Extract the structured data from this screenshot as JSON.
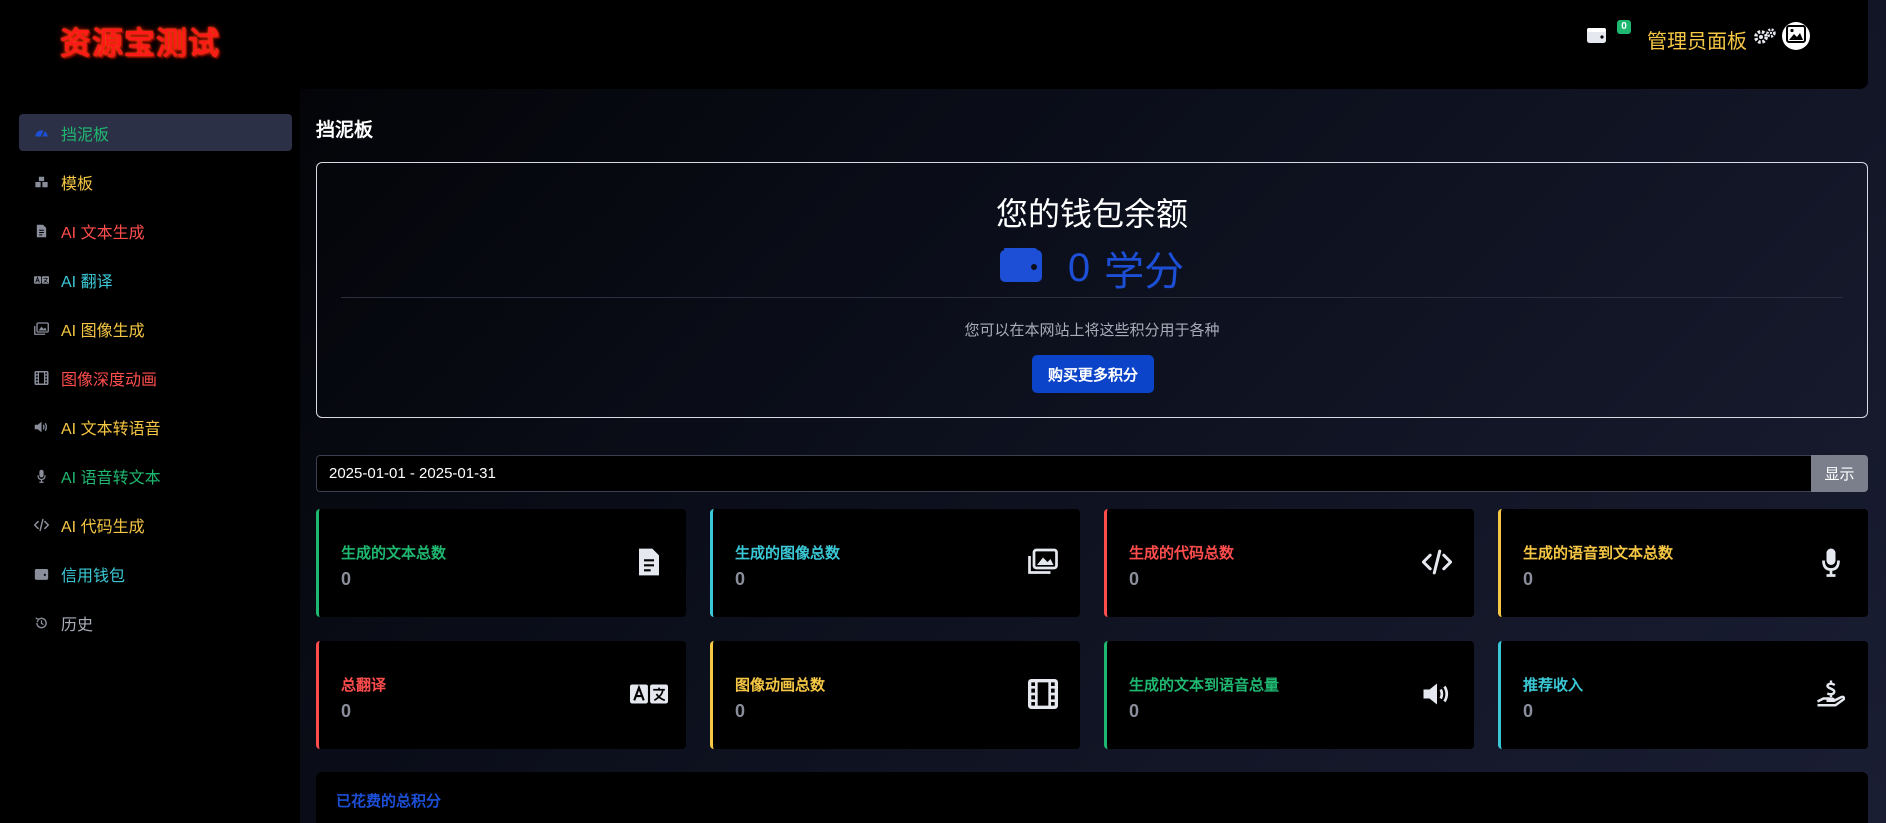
{
  "brand": {
    "name": "资源宝测试"
  },
  "sidebar": {
    "items": [
      {
        "label": "挡泥板",
        "icon": "dashboard-gauge-icon",
        "color": "#1fb870",
        "iconColor": "#1c4fd6",
        "active": true
      },
      {
        "label": "模板",
        "icon": "boxes-icon",
        "color": "#f6c744",
        "iconColor": "#8a8e9b",
        "active": false
      },
      {
        "label": "AI 文本生成",
        "icon": "file-text-icon",
        "color": "#ff4d4d",
        "iconColor": "#8a8e9b",
        "active": false
      },
      {
        "label": "AI 翻译",
        "icon": "translate-icon",
        "color": "#3bc8d6",
        "iconColor": "#8a8e9b",
        "active": false
      },
      {
        "label": "AI 图像生成",
        "icon": "images-icon",
        "color": "#f6c744",
        "iconColor": "#8a8e9b",
        "active": false
      },
      {
        "label": "图像深度动画",
        "icon": "film-icon",
        "color": "#ff4d4d",
        "iconColor": "#8a8e9b",
        "active": false
      },
      {
        "label": "AI 文本转语音",
        "icon": "volume-icon",
        "color": "#f6c744",
        "iconColor": "#8a8e9b",
        "active": false
      },
      {
        "label": "AI 语音转文本",
        "icon": "microphone-icon",
        "color": "#1fb870",
        "iconColor": "#8a8e9b",
        "active": false
      },
      {
        "label": "AI 代码生成",
        "icon": "code-icon",
        "color": "#f6c744",
        "iconColor": "#8a8e9b",
        "active": false
      },
      {
        "label": "信用钱包",
        "icon": "wallet-icon",
        "color": "#3bc8d6",
        "iconColor": "#8a8e9b",
        "active": false
      },
      {
        "label": "历史",
        "icon": "history-icon",
        "color": "#a9adba",
        "iconColor": "#8a8e9b",
        "active": false
      }
    ]
  },
  "header": {
    "wallet_badge": "0",
    "admin_label": "管理员面板"
  },
  "page": {
    "title": "挡泥板"
  },
  "wallet": {
    "title": "您的钱包余额",
    "balance": "0",
    "unit": "学分",
    "description": "您可以在本网站上将这些积分用于各种",
    "buy_label": "购买更多积分"
  },
  "filter": {
    "date_range": "2025-01-01 - 2025-01-31",
    "show_label": "显示"
  },
  "stats": [
    {
      "label": "生成的文本总数",
      "value": "0",
      "color": "#1fb870",
      "icon": "file-text-icon"
    },
    {
      "label": "生成的图像总数",
      "value": "0",
      "color": "#3bc8d6",
      "icon": "images-icon"
    },
    {
      "label": "生成的代码总数",
      "value": "0",
      "color": "#ff4d4d",
      "icon": "code-icon"
    },
    {
      "label": "生成的语音到文本总数",
      "value": "0",
      "color": "#f6c744",
      "icon": "microphone-icon"
    },
    {
      "label": "总翻译",
      "value": "0",
      "color": "#ff4d4d",
      "icon": "translate-icon"
    },
    {
      "label": "图像动画总数",
      "value": "0",
      "color": "#f6c744",
      "icon": "film-icon"
    },
    {
      "label": "生成的文本到语音总量",
      "value": "0",
      "color": "#1fb870",
      "icon": "volume-icon"
    },
    {
      "label": "推荐收入",
      "value": "0",
      "color": "#3bc8d6",
      "icon": "hand-dollar-icon"
    }
  ],
  "spent": {
    "title": "已花费的总积分"
  }
}
